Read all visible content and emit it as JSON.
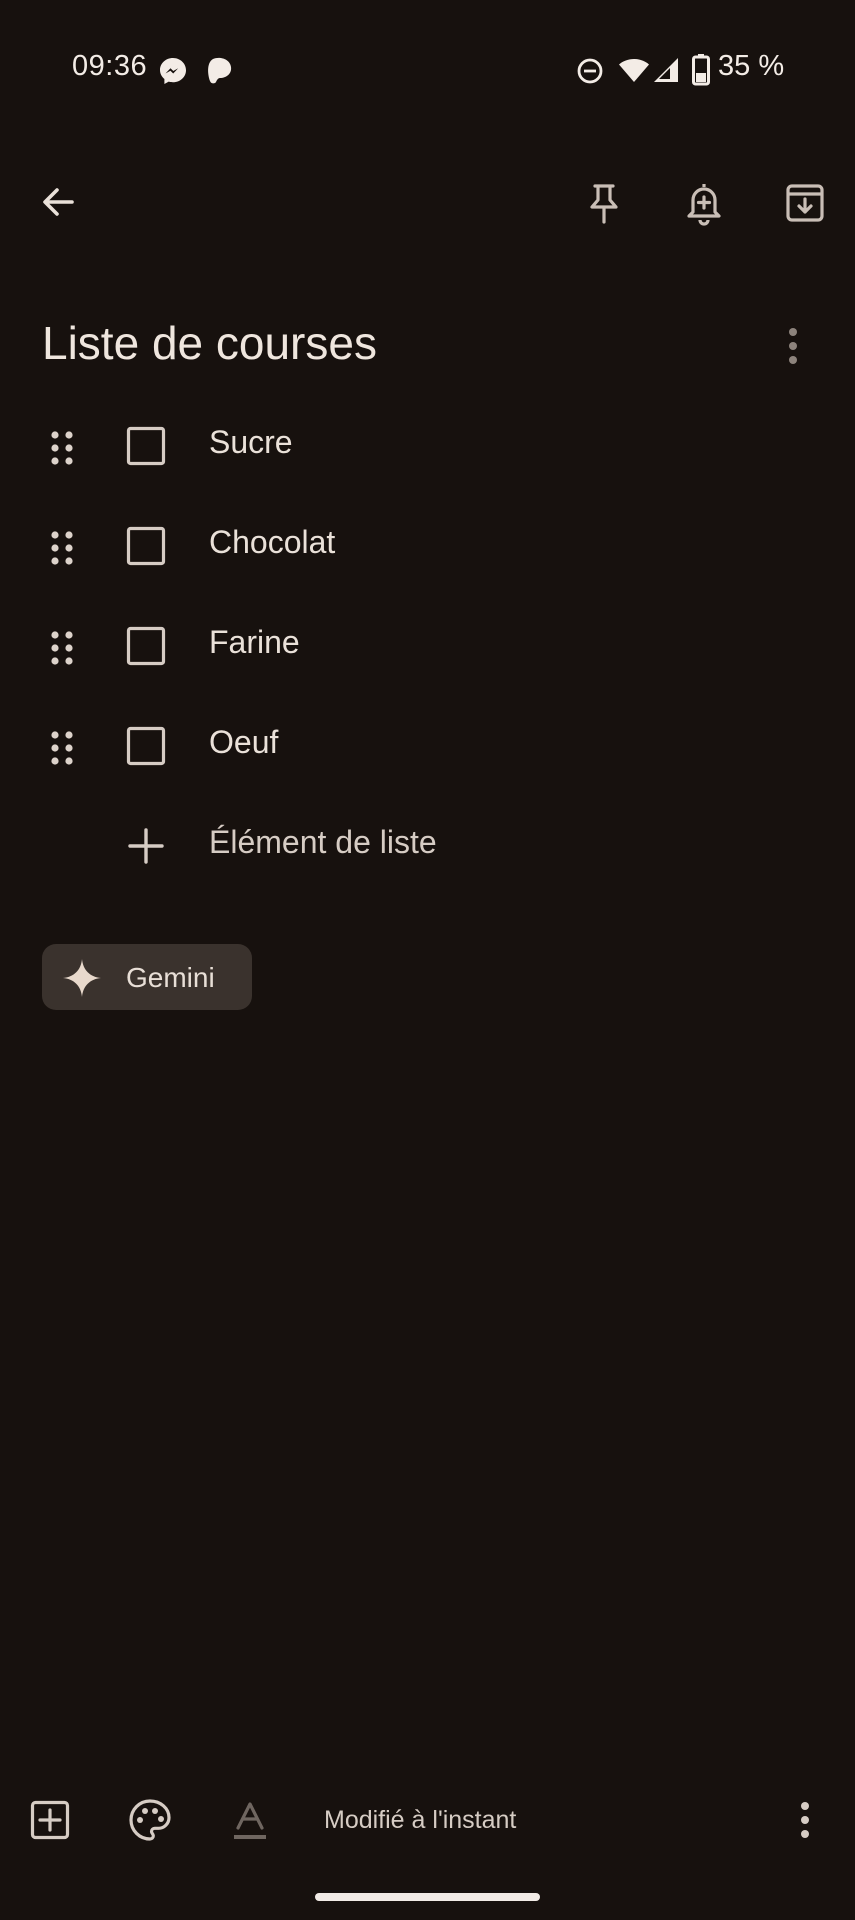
{
  "status_bar": {
    "time": "09:36",
    "battery": "35 %"
  },
  "note": {
    "title": "Liste de courses",
    "items": [
      {
        "label": "Sucre",
        "checked": false
      },
      {
        "label": "Chocolat",
        "checked": false
      },
      {
        "label": "Farine",
        "checked": false
      },
      {
        "label": "Oeuf",
        "checked": false
      }
    ],
    "add_item_placeholder": "Élément de liste"
  },
  "gemini": {
    "label": "Gemini"
  },
  "bottom_bar": {
    "modified_text": "Modifié à l'instant"
  },
  "colors": {
    "background": "#17110e",
    "text": "#eae1d9",
    "chip": "#3a322d"
  }
}
